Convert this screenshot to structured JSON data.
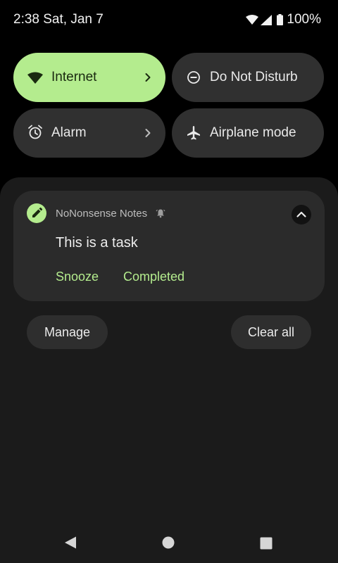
{
  "status_bar": {
    "time": "2:38 Sat, Jan 7",
    "battery": "100%",
    "icons": [
      "wifi-icon",
      "cell-signal-icon",
      "battery-icon"
    ]
  },
  "quick_tiles": [
    {
      "label": "Internet",
      "icon": "wifi-icon",
      "active": true,
      "has_chevron": true
    },
    {
      "label": "Do Not Disturb",
      "icon": "dnd-icon",
      "active": false,
      "has_chevron": false
    },
    {
      "label": "Alarm",
      "icon": "alarm-clock-icon",
      "active": false,
      "has_chevron": true
    },
    {
      "label": "Airplane mode",
      "icon": "airplane-icon",
      "active": false,
      "has_chevron": false
    }
  ],
  "notification": {
    "app_name": "NoNonsense Notes",
    "title": "This is a task",
    "actions": [
      "Snooze",
      "Completed"
    ]
  },
  "footer_buttons": {
    "manage": "Manage",
    "clear_all": "Clear all"
  },
  "colors": {
    "accent": "#b4ec8e",
    "shade_background": "#1b1b1b",
    "card_background": "#2b2b2b",
    "tile_off": "#303030"
  }
}
